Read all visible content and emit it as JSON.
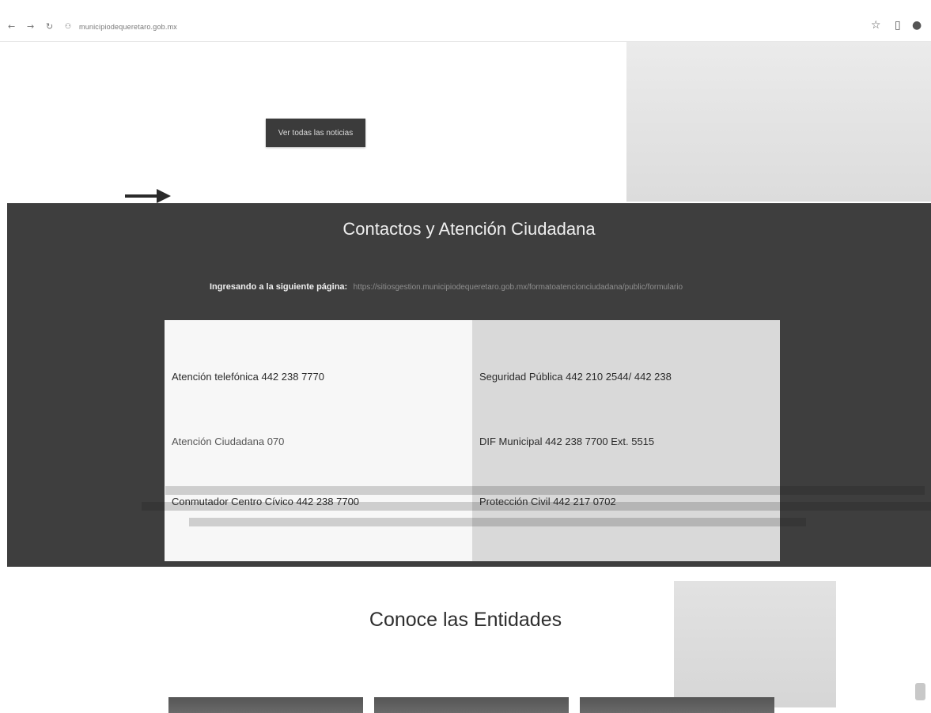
{
  "browser": {
    "back_icon": "←",
    "forward_icon": "→",
    "reload_icon": "↻",
    "site_info_icon": "⚇",
    "url": "municipiodequeretaro.gob.mx",
    "star_icon": "☆",
    "panel_icon": "▯",
    "profile_icon": "●"
  },
  "news": {
    "button_label": "Ver todas las noticias"
  },
  "contacts": {
    "title": "Contactos y Atención Ciudadana",
    "intro_label": "Ingresando a la siguiente página:",
    "intro_link": "https://sitiosgestion.municipiodequeretaro.gob.mx/formatoatencionciudadana/public/formulario",
    "items": [
      {
        "label": "Atención telefónica 442 238 7770"
      },
      {
        "label": "Seguridad Pública 442 210 2544/ 442 238"
      },
      {
        "label": "Atención Ciudadana 070"
      },
      {
        "label": "DIF Municipal 442 238 7700 Ext. 5515"
      },
      {
        "label": "Conmutador Centro Cívico 442 238 7700"
      },
      {
        "label": "Protección Civil 442 217 0702"
      }
    ]
  },
  "entities": {
    "title": "Conoce las Entidades"
  },
  "colors": {
    "section_bg": "#3e3e3e",
    "button_bg": "#3b3b3b",
    "card_bg": "#f7f7f7"
  }
}
